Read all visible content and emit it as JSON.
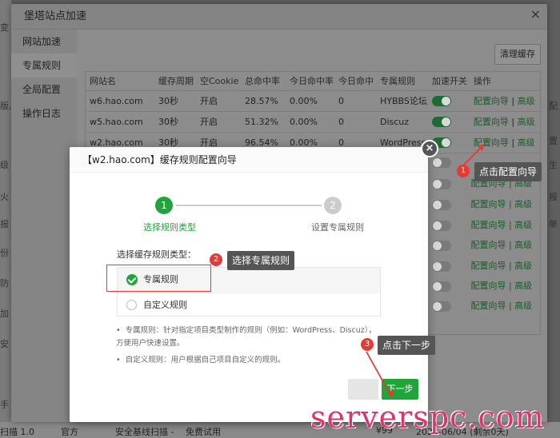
{
  "layer": {
    "title": "堡塔站点加速",
    "close": "×",
    "sidebar": [
      "网站加速",
      "专属规则",
      "全局配置",
      "操作日志"
    ],
    "clear_cache": "清理缓存"
  },
  "table": {
    "headers": [
      "网站名",
      "缓存周期",
      "空Cookie",
      "总命中率",
      "今日命中率",
      "今日命中",
      "专属规则",
      "加速开关",
      "操作"
    ],
    "rows": [
      {
        "site": "w6.hao.com",
        "period": "30秒",
        "cookie": "开启",
        "total": "28.57%",
        "today_rate": "0.00%",
        "today_hit": "0",
        "rule": "HYBBS论坛",
        "switch": true,
        "op1": "配置向导",
        "sep": "|",
        "op2": "高级"
      },
      {
        "site": "w5.hao.com",
        "period": "30秒",
        "cookie": "开启",
        "total": "51.32%",
        "today_rate": "0.00%",
        "today_hit": "0",
        "rule": "Discuz",
        "switch": true,
        "op1": "配置向导",
        "sep": "|",
        "op2": "高级"
      },
      {
        "site": "w2.hao.com",
        "period": "30秒",
        "cookie": "开启",
        "total": "96.54%",
        "today_rate": "0.00%",
        "today_hit": "0",
        "rule": "WordPress",
        "switch": true,
        "op1": "配置向导",
        "sep": "|",
        "op2": "高级"
      }
    ],
    "more_rows_ops": "配置向导 | 高级"
  },
  "dialog": {
    "title": "【w2.hao.com】缓存规则配置向导",
    "close": "×",
    "step1_num": "1",
    "step1_label": "选择规则类型",
    "step2_num": "2",
    "step2_label": "设置专属规则",
    "choose_label": "选择缓存规则类型：",
    "option1": "专属规则",
    "option2": "自定义规则",
    "hint1": "专属规则：针对指定项目类型制作的规则（例如：WordPress、Discuz），方便用户快速设置。",
    "hint2": "自定义规则：用户根据自己项目自定义的规则。",
    "next": "下一步"
  },
  "annotations": {
    "badge1": "1",
    "callout1": "点击配置向导",
    "badge2": "2",
    "callout2": "选择专属规则",
    "badge3": "3",
    "callout3": "点击下一步",
    "watermark": "serverspc.com"
  },
  "bg": {
    "left": [
      "变",
      "版。",
      "级",
      "火",
      "报",
      "份",
      "防",
      "加",
      "安",
      "手"
    ],
    "right": [
      "配",
      "置",
      "生",
      "报",
      "单"
    ],
    "bottom": {
      "a": "扫描 1.0",
      "b": "官方",
      "c": "安全基线扫描 -",
      "d": "免费试用",
      "e": "¥99",
      "f": "2021-06/04 (剩余0天)"
    }
  },
  "colors": {
    "accent": "#20a53a",
    "annotation": "#e53935",
    "watermark": "#e0336e"
  }
}
